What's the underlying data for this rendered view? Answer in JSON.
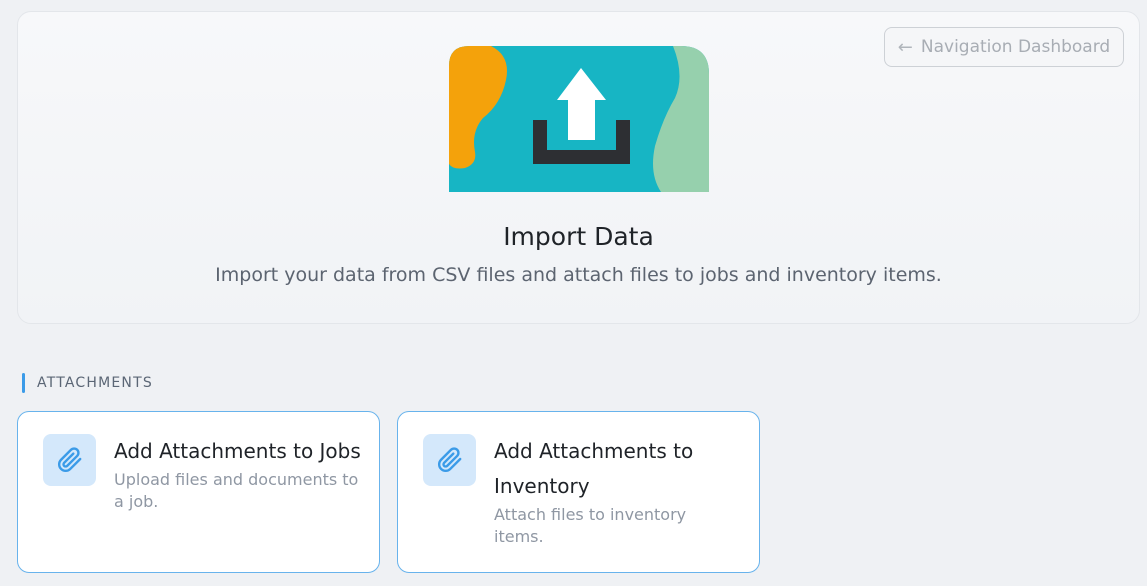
{
  "header": {
    "nav_button_label": "Navigation Dashboard",
    "title": "Import Data",
    "subtitle": "Import your data from CSV files and attach files to jobs and inventory items."
  },
  "section": {
    "label": "ATTACHMENTS"
  },
  "cards": [
    {
      "title": "Add Attachments to Jobs",
      "description": "Upload files and documents to a job.",
      "icon": "paperclip-icon"
    },
    {
      "title": "Add Attachments to Inventory",
      "description": "Attach files to inventory items.",
      "icon": "paperclip-icon"
    }
  ],
  "colors": {
    "accent": "#3b9be8",
    "illustration_teal": "#17b5c4",
    "illustration_orange": "#f4a20b",
    "illustration_green": "#96d0ad"
  }
}
